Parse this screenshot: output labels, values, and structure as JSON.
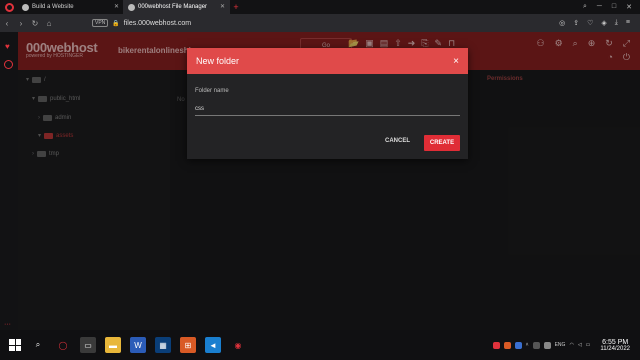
{
  "browser": {
    "tabs": [
      {
        "title": "Build a Website",
        "active": false
      },
      {
        "title": "000webhost File Manager",
        "active": true
      }
    ],
    "new_tab": "+",
    "vpn": "VPN",
    "url": "files.000webhost.com"
  },
  "header": {
    "brand": "000webhost",
    "brand_sub": "powered by HOSTINGER",
    "site_name": "bikerentalonlineshi",
    "go_label": "Go"
  },
  "tree": {
    "root": "/",
    "items": [
      {
        "label": "public_html"
      },
      {
        "label": "admin"
      },
      {
        "label": "assets"
      },
      {
        "label": "tmp"
      }
    ]
  },
  "main": {
    "permissions_header": "Permissions",
    "no_files": "No"
  },
  "modal": {
    "title": "New folder",
    "close": "×",
    "field_label": "Folder name",
    "field_value": "css",
    "cancel_label": "CANCEL",
    "create_label": "CREATE"
  },
  "taskbar": {
    "lang": "ENG",
    "time": "6:55 PM",
    "date": "11/24/2022"
  },
  "colors": {
    "accent": "#e02d36",
    "header_bg": "#8c2121",
    "modal_head": "#e04a4a"
  }
}
